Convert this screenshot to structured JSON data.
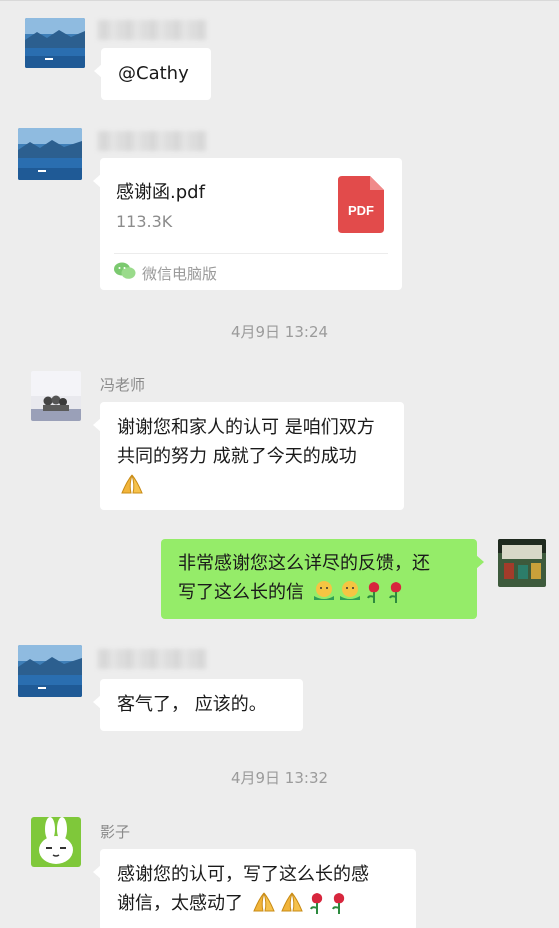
{
  "messages": {
    "m1": {
      "text": "@Cathy"
    },
    "m2": {
      "file_name": "感谢函.pdf",
      "file_size": "113.3K",
      "file_type_label": "PDF",
      "source": "微信电脑版"
    },
    "t1": {
      "time": "4月9日 13:24"
    },
    "m3": {
      "sender": "冯老师",
      "text": "谢谢您和家人的认可 是咱们双方共同的努力 成就了今天的成功"
    },
    "m4": {
      "line1": "非常感谢您这么详尽的反馈，还",
      "line2": "写了这么长的信"
    },
    "m5": {
      "text": "客气了， 应该的。"
    },
    "t2": {
      "time": "4月9日 13:32"
    },
    "m6": {
      "sender": "影子",
      "line1": "感谢您的认可，写了这么长的感",
      "line2": "谢信，太感动了"
    }
  },
  "colors": {
    "background": "#ededed",
    "bubble_other": "#ffffff",
    "bubble_self": "#95ec69",
    "pdf_red": "#e24b4b",
    "timestamp": "#9b9b9b"
  },
  "icons": [
    "landscape-avatar",
    "people-avatar",
    "photo-avatar",
    "rabbit-avatar",
    "pdf-icon",
    "wechat-icon",
    "pray-emoji",
    "hug-emoji",
    "rose-emoji"
  ]
}
